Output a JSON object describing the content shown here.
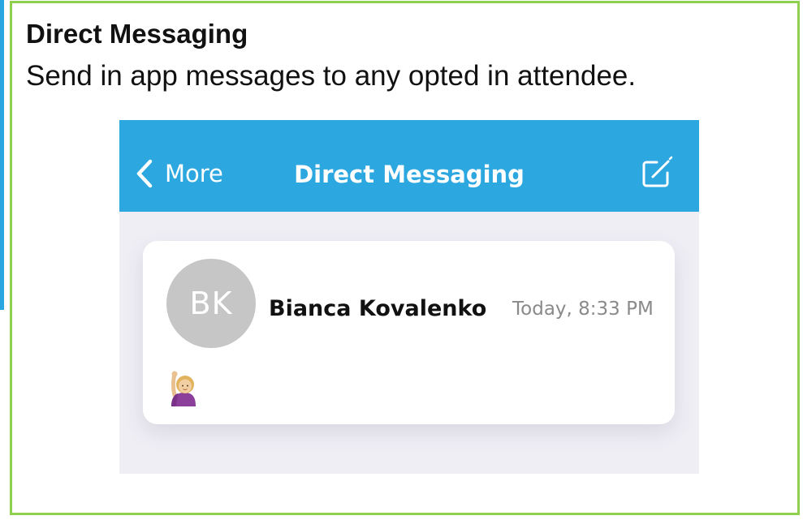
{
  "slide": {
    "title": "Direct Messaging",
    "subtitle": "Send in app messages to any opted in attendee."
  },
  "app": {
    "navbar": {
      "back_label": "More",
      "title": "Direct Messaging",
      "back_icon": "chevron-left-icon",
      "compose_icon": "compose-icon",
      "background_color": "#2ca7e0"
    },
    "conversations": [
      {
        "avatar_initials": "BK",
        "name": "Bianca Kovalenko",
        "timestamp": "Today, 8:33 PM",
        "preview_icon": "person-raising-hand-emoji"
      }
    ]
  },
  "colors": {
    "frame_border": "#8fd14f",
    "left_accent": "#29a6e0",
    "screen_background": "#efeef5",
    "avatar_background": "#c6c6c6"
  }
}
